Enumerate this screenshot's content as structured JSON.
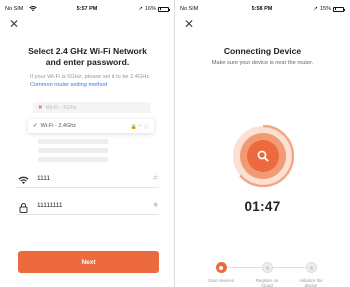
{
  "colors": {
    "accent": "#ec6a3d",
    "link": "#3b7be0",
    "ring_outer": "#f7c3ab",
    "ring_mid": "#f19a73"
  },
  "left": {
    "status": {
      "carrier": "No SIM",
      "time": "5:57 PM",
      "battery": "16%",
      "battery_level": 0.16
    },
    "title_line1": "Select 2.4 GHz Wi-Fi Network",
    "title_line2": "and enter password.",
    "hint_text": "If your Wi-Fi is 5GHz, please set it to be 2.4GHz.",
    "hint_link": "Common router setting method",
    "networks": [
      {
        "label": "Wi-Fi - 5Ghz",
        "state": "invalid"
      },
      {
        "label": "Wi-Fi - 2.4Ghz",
        "state": "valid"
      }
    ],
    "ssid_value": "1111",
    "ssid_tail": "⇄",
    "password_value": "11111111",
    "password_tail": "◉",
    "next_label": "Next"
  },
  "right": {
    "status": {
      "carrier": "No SIM",
      "time": "5:58 PM",
      "battery": "15%",
      "battery_level": 0.15
    },
    "title": "Connecting Device",
    "subtitle": "Make sure your device is near the router.",
    "timer": "01:47",
    "steps": [
      {
        "label": "Scan devices",
        "active": true
      },
      {
        "label": "Register on Cloud",
        "active": false
      },
      {
        "label": "Initialize the device",
        "active": false
      }
    ]
  },
  "icons": {
    "close": "close-icon",
    "search": "search-icon",
    "wifi": "wifi-icon",
    "lock": "lock-icon",
    "eye": "eye-icon"
  }
}
